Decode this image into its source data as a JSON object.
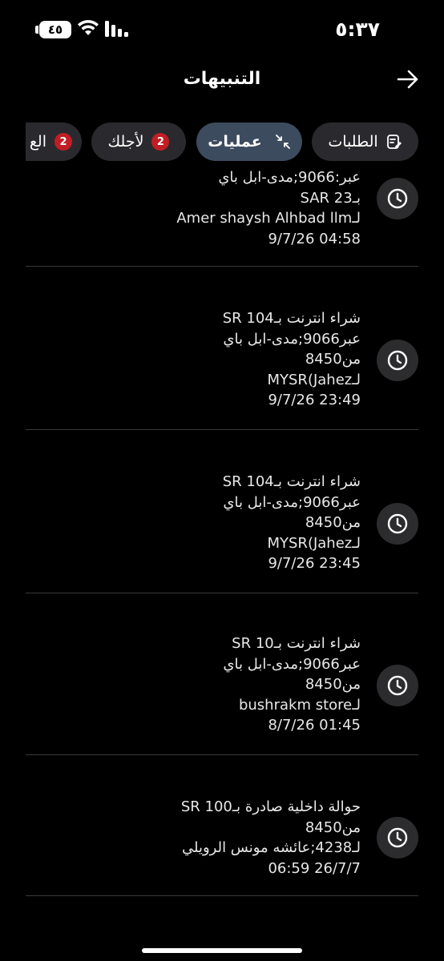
{
  "status_bar": {
    "time": "٥:٣٧",
    "battery": "٤٥"
  },
  "header": {
    "title": "التنبيهات"
  },
  "tabs": [
    {
      "label": "الطلبات",
      "icon": "edit-document-icon"
    },
    {
      "label": "عمليات",
      "icon": "collapse-arrows-icon",
      "active": true
    },
    {
      "label": "لأجلك",
      "badge": "2"
    },
    {
      "label": "الع",
      "badge": "2"
    }
  ],
  "notifications": [
    {
      "lines": [
        "عبر:9066;مدى-ابل باي",
        "بـSAR 23",
        "لـAmer shaysh Alhbad llm",
        "04:58 9/7/26"
      ]
    },
    {
      "lines": [
        "شراء انترنت بـSR 104",
        "عبر9066;مدى-ابل باي",
        "من8450",
        "لـMYSR(Jahez",
        "23:49 9/7/26"
      ]
    },
    {
      "lines": [
        "شراء انترنت بـSR 104",
        "عبر9066;مدى-ابل باي",
        "من8450",
        "لـMYSR(Jahez",
        "23:45 9/7/26"
      ]
    },
    {
      "lines": [
        "شراء انترنت بـSR 10",
        "عبر9066;مدى-ابل باي",
        "من8450",
        "لـbushrakm store",
        "01:45 8/7/26"
      ]
    },
    {
      "lines": [
        "حوالة داخلية صادرة بـSR 100",
        "من8450",
        "لـ4238;عائشه مونس الرويلي",
        "26/7/7 06:59"
      ]
    }
  ],
  "colors": {
    "background": "#000000",
    "tab_bg": "#2a2a2e",
    "tab_active_bg": "#3d4b5e",
    "badge": "#c21d24",
    "divider": "#3a3a3c"
  }
}
